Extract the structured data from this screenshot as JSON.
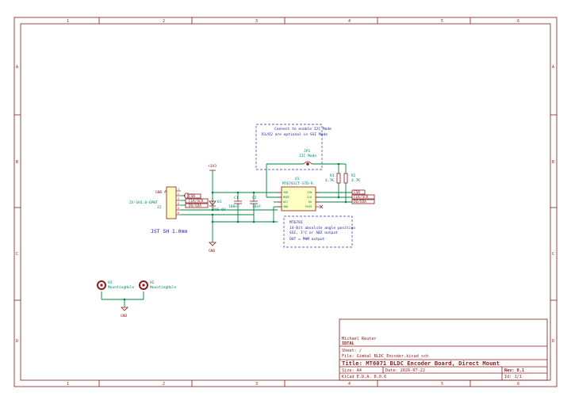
{
  "zones": {
    "columns": [
      "1",
      "2",
      "3",
      "4",
      "5",
      "6"
    ],
    "rows": [
      "A",
      "B",
      "C",
      "D"
    ]
  },
  "notes": {
    "i2c_note_line1": "Connect to enable I2C Mode",
    "i2c_note_line2": "R1/R2 are optional in SSI Mode",
    "mt_note_line1": "MT6701",
    "mt_note_line2": "14-Bit absolute angle position",
    "mt_note_line3": "SSI, I²C or ABZ output",
    "mt_note_line4": "OUT = PWM output"
  },
  "connector": {
    "ref": "J2",
    "value": "ZX-SH1.0-6PWT",
    "caption": "JST SH 1.0mm",
    "pins": [
      "1",
      "2",
      "3",
      "4",
      "5",
      "6"
    ]
  },
  "labels": {
    "csn": "CSN",
    "clk_scl": "CLK/SCK",
    "do_sda": "DO/SDA"
  },
  "power": {
    "vcc": "+3V3",
    "gnd": "GND"
  },
  "diode": {
    "ref": "D1",
    "value": "TVS 6V"
  },
  "c1": {
    "ref": "C1",
    "value": "100nF"
  },
  "c2": {
    "ref": "C2",
    "value": "10nF"
  },
  "jumper": {
    "ref": "JP1",
    "value": "I2C Mode"
  },
  "r1": {
    "ref": "R1",
    "value": "4.7K"
  },
  "r2": {
    "ref": "R2",
    "value": "4.7K"
  },
  "ic": {
    "ref": "U1",
    "value": "MT6701CT-STD-R",
    "pins_left": [
      "VDD",
      "MODE",
      "OUT",
      "GND"
    ],
    "pins_right": [
      "CSN",
      "CLK",
      "DO",
      "PUSH"
    ]
  },
  "mounting": [
    {
      "ref": "H1",
      "value": "MountingHole"
    },
    {
      "ref": "H2",
      "value": "MountingHole"
    }
  ],
  "title_block": {
    "author": "Michael Reuter",
    "company": "IDTAL",
    "sheet": "Sheet: /",
    "file": "File: Gimbal_BLDC_Encoder.kicad_sch",
    "title": "Title: MT6071 BLDC Encoder Board, Direct Mount",
    "size": "Size: A4",
    "date": "Date: 2026-07-22",
    "rev": "Rev: 0.1",
    "kicad": "KiCad E.D.A. 8.0.6",
    "id": "Id: 1/1"
  }
}
